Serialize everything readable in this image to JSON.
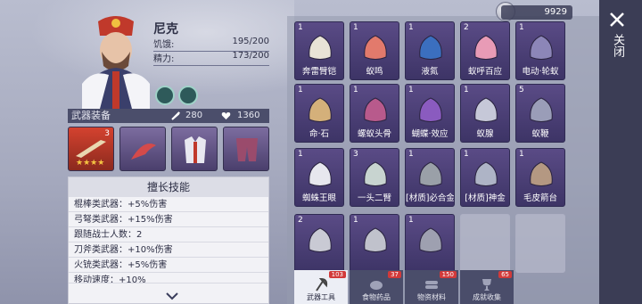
{
  "hero": {
    "name": "尼克",
    "hunger_label": "饥饿:",
    "hunger_value": "195/200",
    "energy_label": "精力:",
    "energy_value": "173/200"
  },
  "weapons": {
    "title": "武器装备",
    "attack": "280",
    "health": "1360",
    "slot1_level": "3"
  },
  "skills": {
    "title": "擅长技能",
    "rows": [
      "棍棒类武器：+5%伤害",
      "弓弩类武器：+15%伤害",
      "跟随战士人数：2",
      "刀斧类武器：+10%伤害",
      "火铳类武器：+5%伤害",
      "移动速度：+10%"
    ]
  },
  "currency": {
    "amount": "9929"
  },
  "close_label": "关闭",
  "items": [
    {
      "count": "1",
      "label": "奔雷臂铠"
    },
    {
      "count": "1",
      "label": "蚁鸣"
    },
    {
      "count": "1",
      "label": "液氮"
    },
    {
      "count": "2",
      "label": "蚁呼百应"
    },
    {
      "count": "1",
      "label": "电动·轮蚁"
    },
    {
      "count": "1",
      "label": "命·石"
    },
    {
      "count": "1",
      "label": "螺蚁头骨"
    },
    {
      "count": "1",
      "label": "蝴蝶·效应"
    },
    {
      "count": "1",
      "label": "蚁腺"
    },
    {
      "count": "5",
      "label": "蚁鞭"
    },
    {
      "count": "1",
      "label": "蜘蛛王眼"
    },
    {
      "count": "3",
      "label": "一头二臂"
    },
    {
      "count": "1",
      "label": "[材质]必合金"
    },
    {
      "count": "1",
      "label": "[材质]神金"
    },
    {
      "count": "1",
      "label": "毛皮箭台"
    },
    {
      "count": "2",
      "label": ""
    },
    {
      "count": "1",
      "label": ""
    },
    {
      "count": "1",
      "label": ""
    }
  ],
  "tabs": [
    {
      "label": "武器工具",
      "badge": "103"
    },
    {
      "label": "食物药品",
      "badge": "37"
    },
    {
      "label": "物资材料",
      "badge": "150"
    },
    {
      "label": "成就收集",
      "badge": "65"
    }
  ],
  "colors": {
    "item_bg": "#4a3f74",
    "badge": "#d23a3a",
    "side_panel": "#3b3d55"
  }
}
